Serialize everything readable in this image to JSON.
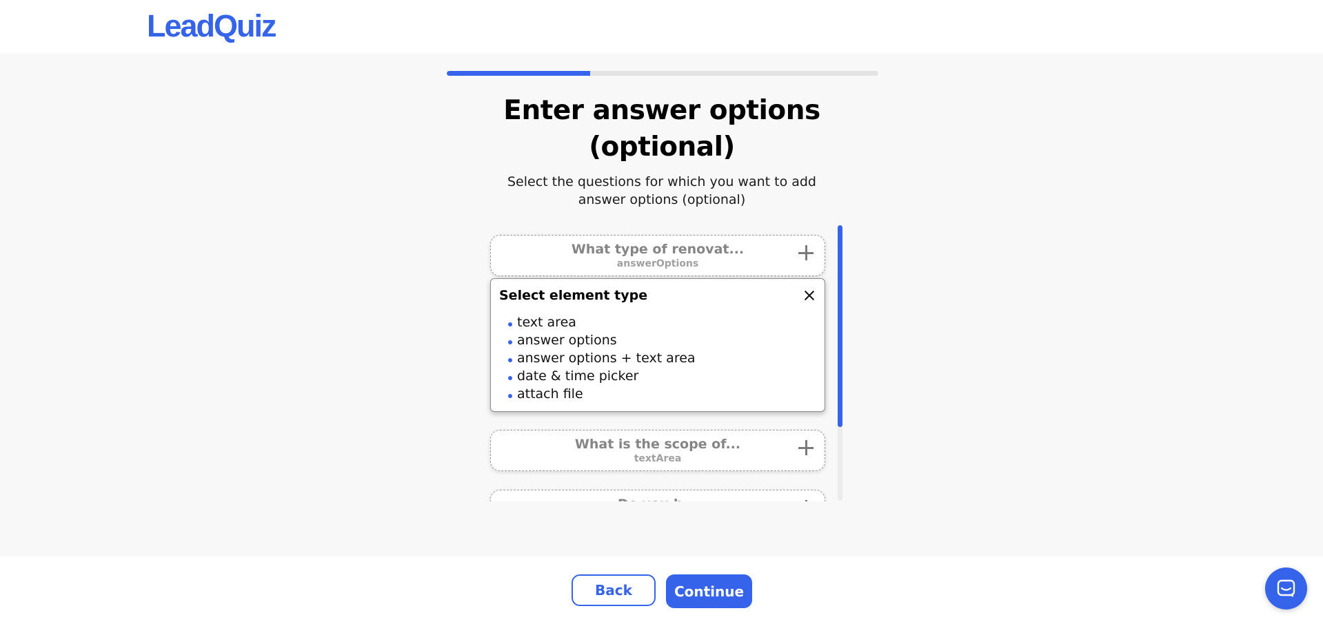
{
  "brand": {
    "logo_text": "LeadQuiz",
    "accent_color": "#3563e9"
  },
  "progress": {
    "fraction": 0.333
  },
  "page": {
    "title_line1": "Enter answer options",
    "title_line2": "(optional)",
    "subtitle_line1": "Select the questions for which you want to add",
    "subtitle_line2": "answer options (optional)"
  },
  "questions": [
    {
      "title": "What type of renovat...",
      "type": "answerOptions"
    },
    {
      "title": "What is the scope of...",
      "type": "textArea"
    },
    {
      "title": "Do you h...",
      "type": ""
    }
  ],
  "element_type_popup": {
    "title": "Select element type",
    "options": [
      "text area",
      "answer options",
      "answer options + text area",
      "date & time picker",
      "attach file"
    ]
  },
  "footer": {
    "back_label": "Back",
    "continue_label": "Continue"
  },
  "icons": {
    "add": "plus-icon",
    "close": "close-icon",
    "chat": "chat-icon"
  }
}
